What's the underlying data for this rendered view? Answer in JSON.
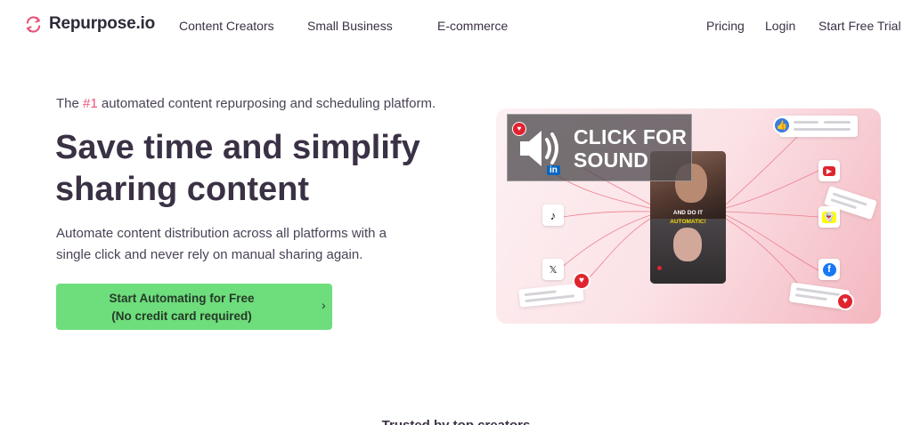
{
  "brand": {
    "name": "Repurpose.io",
    "accent": "#e8547a"
  },
  "nav": {
    "links": [
      "Content Creators",
      "Small Business",
      "E-commerce"
    ],
    "right": {
      "pricing": "Pricing",
      "login": "Login",
      "trial": "Start Free Trial"
    }
  },
  "hero": {
    "tagline_pre": "The ",
    "tagline_hl": "#1",
    "tagline_post": " automated content repurposing and scheduling platform.",
    "headline_line1": "Save time and simplify",
    "headline_line2": "sharing content",
    "sub": "Automate content distribution across all platforms with a single click and never rely on manual sharing again.",
    "cta_line1": "Start Automating for Free",
    "cta_line2": "(No credit card required)",
    "cta_arrow": "›",
    "cta_color": "#6edd7c"
  },
  "visual": {
    "sound_line1": "CLICK FOR",
    "sound_line2": "SOUND",
    "phone_caption1": "AND DO IT",
    "phone_caption2": "AUTOMATIC!",
    "icons": [
      "linkedin-icon",
      "tiktok-icon",
      "x-icon",
      "youtube-icon",
      "snapchat-icon",
      "facebook-icon",
      "heart-icon",
      "like-icon"
    ],
    "linkedin_label": "in",
    "tiktok_label": "♪",
    "x_label": "𝕏",
    "youtube_label": "▶",
    "snapchat_label": "👻",
    "facebook_label": "f",
    "heart_label": "♥",
    "like_label": "👍"
  },
  "trusted": "Trusted by top creators"
}
